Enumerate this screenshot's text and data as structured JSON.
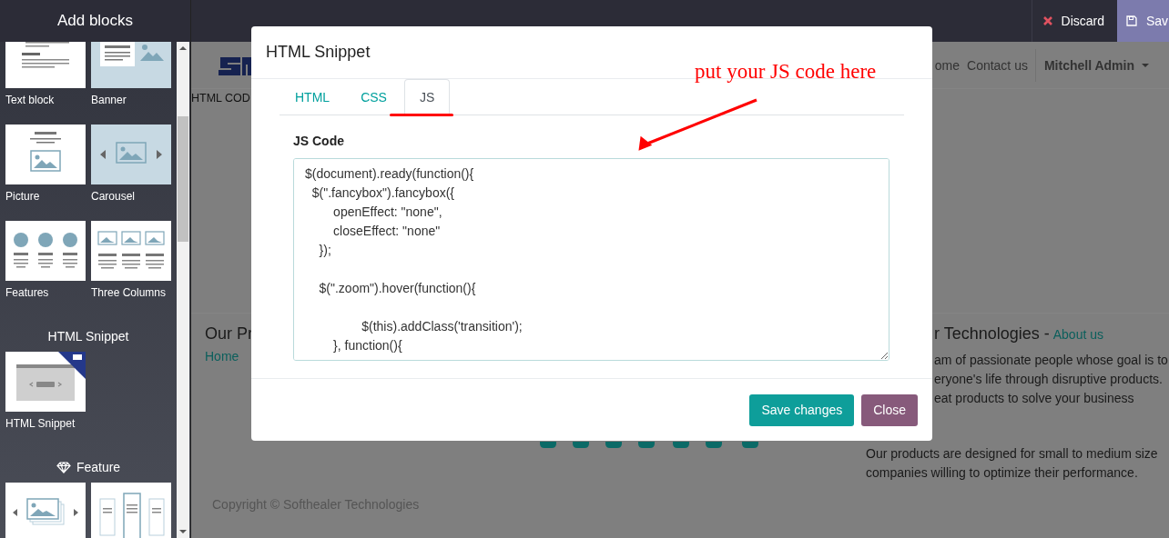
{
  "sidebar": {
    "title": "Add blocks",
    "groups": [
      {
        "blocks": [
          {
            "label": "Text block",
            "kind": "text"
          },
          {
            "label": "Banner",
            "kind": "banner"
          },
          {
            "label": "Picture",
            "kind": "picture"
          },
          {
            "label": "Carousel",
            "kind": "carousel"
          },
          {
            "label": "Features",
            "kind": "features"
          },
          {
            "label": "Three Columns",
            "kind": "columns"
          }
        ]
      },
      {
        "heading": "HTML Snippet",
        "blocks": [
          {
            "label": "HTML Snippet",
            "kind": "html"
          }
        ]
      },
      {
        "heading": "Feature",
        "blocks": [
          {
            "kind": "gallery"
          },
          {
            "kind": "cards"
          }
        ]
      }
    ]
  },
  "topbar": {
    "actions": [
      {
        "label": "Discard",
        "kind": "discard"
      },
      {
        "label": "Sav",
        "kind": "save"
      }
    ]
  },
  "page": {
    "nav": [
      "ome",
      "Contact us"
    ],
    "user": "Mitchell Admin",
    "snippet_text": "HTML COD",
    "footer_left": {
      "heading": "Our Pr",
      "link": "Home"
    },
    "footer_right": {
      "heading": "r Technologies -",
      "link": "About us",
      "lines": [
        "am of passionate people whose goal is to",
        "eryone's life through disruptive products.",
        "eat products to solve your business"
      ],
      "paragraph": "Our products are designed for small to medium size companies willing to optimize their performance."
    },
    "copyright": "Copyright © Softhealer Technologies"
  },
  "modal": {
    "title": "HTML Snippet",
    "tabs": [
      {
        "label": "HTML",
        "selected": false
      },
      {
        "label": "CSS",
        "selected": false
      },
      {
        "label": "JS",
        "selected": true
      }
    ],
    "field_label": "JS Code",
    "code": "$(document).ready(function(){\n  $(\".fancybox\").fancybox({\n        openEffect: \"none\",\n        closeEffect: \"none\"\n    });\n\n    $(\".zoom\").hover(function(){\n\n                $(this).addClass('transition');\n        }, function(){",
    "buttons": [
      {
        "label": "Save changes",
        "kind": "primary"
      },
      {
        "label": "Close",
        "kind": "secondary"
      }
    ]
  },
  "annotation": {
    "text": "put your JS code here"
  }
}
